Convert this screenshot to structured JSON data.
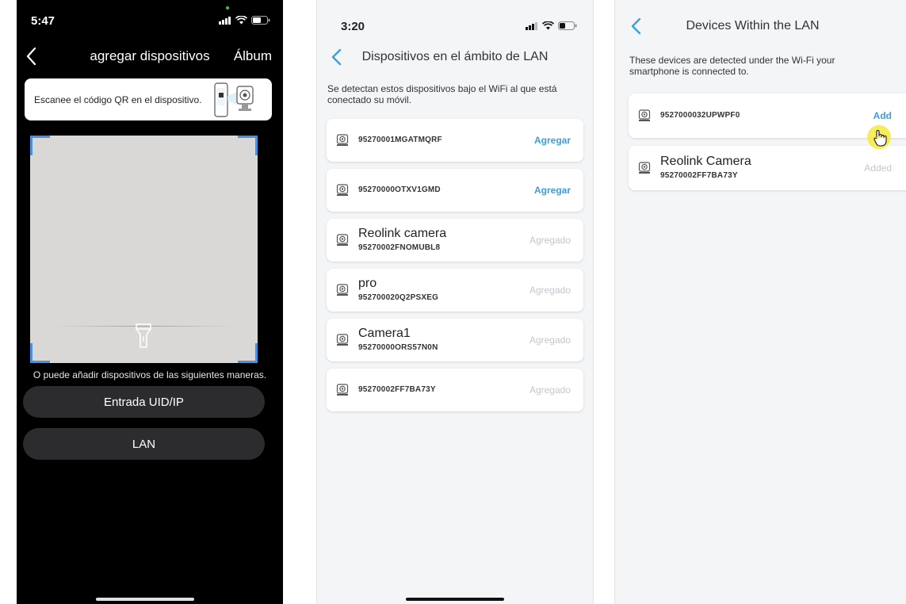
{
  "colors": {
    "accent": "#3aa0dc",
    "disabled": "#c3c6cb",
    "scan_corner": "#4a90e2",
    "dark_bg": "#000000",
    "light_bg": "#f4f5f7"
  },
  "screen1": {
    "time": "5:47",
    "title": "agregar dispositivos",
    "album": "Álbum",
    "qr_hint": "Escanee el código QR en el dispositivo.",
    "alt_text": "O puede añadir dispositivos de las siguientes maneras.",
    "uid_button": "Entrada UID/IP",
    "lan_button": "LAN"
  },
  "screen2": {
    "time": "3:20",
    "title": "Dispositivos en el ámbito de LAN",
    "description": "Se detectan estos dispositivos bajo el WiFi al que está conectado su móvil.",
    "devices": [
      {
        "name": "",
        "uid": "95270001MGATMQRF",
        "action": "Agregar",
        "state": "add"
      },
      {
        "name": "",
        "uid": "95270000OTXV1GMD",
        "action": "Agregar",
        "state": "add"
      },
      {
        "name": "Reolink camera",
        "uid": "95270002FNOMUBL8",
        "action": "Agregado",
        "state": "added"
      },
      {
        "name": "pro",
        "uid": "952700020Q2PSXEG",
        "action": "Agregado",
        "state": "added"
      },
      {
        "name": "Camera1",
        "uid": "95270000ORS57N0N",
        "action": "Agregado",
        "state": "added"
      },
      {
        "name": "",
        "uid": "95270002FF7BA73Y",
        "action": "Agregado",
        "state": "added"
      }
    ]
  },
  "screen3": {
    "title": "Devices Within the LAN",
    "description": "These devices are detected under the Wi-Fi your smartphone is connected to.",
    "devices": [
      {
        "name": "",
        "uid": "9527000032UPWPF0",
        "action": "Add",
        "state": "add"
      },
      {
        "name": "Reolink Camera",
        "uid": "95270002FF7BA73Y",
        "action": "Added",
        "state": "added"
      }
    ]
  }
}
